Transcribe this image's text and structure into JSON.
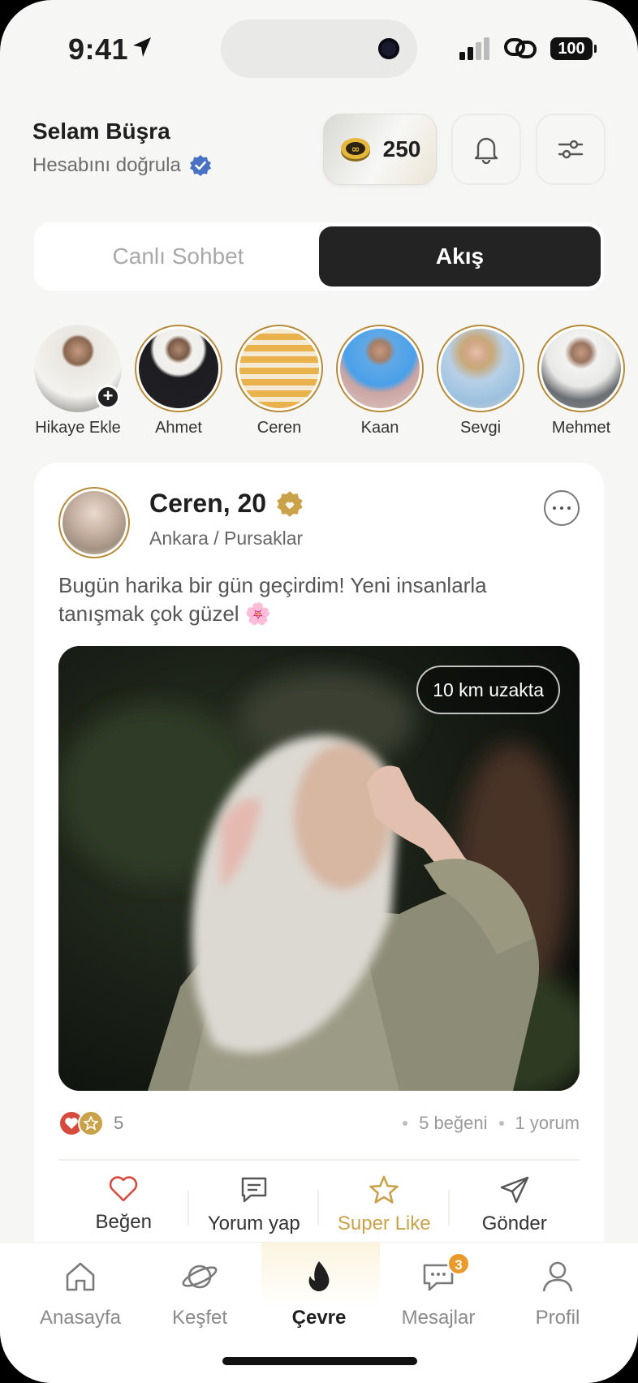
{
  "status_bar": {
    "time": "9:41",
    "battery": "100"
  },
  "header": {
    "greeting": "Selam Büşra",
    "verify_text": "Hesabını doğrula",
    "coins": "250"
  },
  "segment": {
    "left": "Canlı Sohbet",
    "right": "Akış",
    "active": "right"
  },
  "stories": [
    {
      "label": "Hikaye Ekle"
    },
    {
      "label": "Ahmet"
    },
    {
      "label": "Ceren"
    },
    {
      "label": "Kaan"
    },
    {
      "label": "Sevgi"
    },
    {
      "label": "Mehmet"
    }
  ],
  "post": {
    "name": "Ceren, 20",
    "location": "Ankara / Pursaklar",
    "text": "Bugün harika bir gün geçirdim! Yeni insanlarla tanışmak çok güzel 🌸",
    "distance": "10 km uzakta",
    "reaction_count": "5",
    "likes": "5 beğeni",
    "comments": "1 yorum",
    "actions": {
      "like": "Beğen",
      "comment": "Yorum yap",
      "super": "Super Like",
      "send": "Gönder"
    }
  },
  "tabbar": {
    "home": "Anasayfa",
    "explore": "Keşfet",
    "circle": "Çevre",
    "messages": "Mesajlar",
    "messages_badge": "3",
    "profile": "Profil",
    "active": "circle"
  },
  "colors": {
    "gold": "#c9a24a",
    "dark": "#232323",
    "verify_blue": "#4a72c4",
    "heart_red": "#d74b3f",
    "badge_orange": "#e89a2b"
  }
}
